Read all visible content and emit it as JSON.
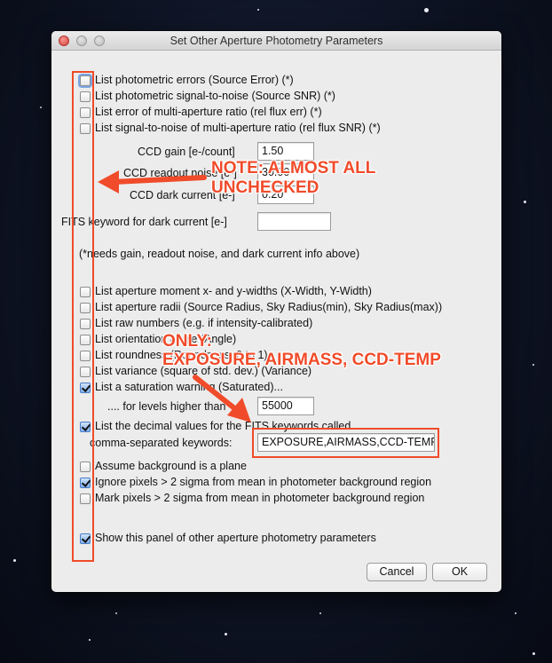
{
  "window": {
    "title": "Set Other Aperture Photometry Parameters"
  },
  "options_top": [
    {
      "label": "List photometric errors (Source Error) (*)",
      "checked": false
    },
    {
      "label": "List photometric signal-to-noise (Source SNR) (*)",
      "checked": false
    },
    {
      "label": "List error of multi-aperture ratio (rel flux err) (*)",
      "checked": false
    },
    {
      "label": "List signal-to-noise of multi-aperture ratio (rel flux SNR) (*)",
      "checked": false
    }
  ],
  "ccd": {
    "gain_label": "CCD gain [e-/count]",
    "gain_value": "1.50",
    "readout_label": "CCD readout noise [e-]",
    "readout_value": "30.00",
    "dark_label": "CCD dark current [e-]",
    "dark_value": "0.20"
  },
  "fits_dark": {
    "label": "FITS keyword for dark current [e-]",
    "value": ""
  },
  "note_needs": "(*needs gain, readout noise, and dark current info above)",
  "options_mid": [
    {
      "label": "List aperture moment x- and y-widths (X-Width, Y-Width)",
      "checked": false
    },
    {
      "label": "List aperture radii (Source Radius, Sky Radius(min), Sky Radius(max))",
      "checked": false
    },
    {
      "label": "List raw numbers (e.g. if intensity-calibrated)",
      "checked": false
    },
    {
      "label": "List orientation angle (Angle)",
      "checked": false
    },
    {
      "label": "List roundness (Roundness, 0 to 1)",
      "checked": false
    },
    {
      "label": "List variance (square of std. dev.) (Variance)",
      "checked": false
    },
    {
      "label": "List a saturation warning (Saturated)...",
      "checked": true
    }
  ],
  "saturation": {
    "label": ".... for levels higher than",
    "value": "55000"
  },
  "fits_values": {
    "label": "List the decimal values for the FITS keywords called...",
    "checked": true,
    "keywords_label": "comma-separated keywords:",
    "keywords_value": "EXPOSURE,AIRMASS,CCD-TEMP"
  },
  "options_bottom": [
    {
      "label": "Assume background is a plane",
      "checked": false
    },
    {
      "label": "Ignore pixels > 2 sigma from mean in photometer background region",
      "checked": true
    },
    {
      "label": "Mark pixels > 2 sigma from mean in photometer background region",
      "checked": false
    }
  ],
  "show_panel": {
    "label": "Show this panel of other aperture photometry parameters",
    "checked": true
  },
  "buttons": {
    "cancel": "Cancel",
    "ok": "OK"
  },
  "annotations": {
    "note_line1": "NOTE: ALMOST ALL",
    "note_line2": "UNCHECKED",
    "only_line1": "ONLY:",
    "only_line2": "EXPOSURE, AIRMASS, CCD-TEMP"
  },
  "colors": {
    "annotation_red": "#f04b2a",
    "check_blue": "#7eaee9",
    "window_bg": "#ececec"
  }
}
